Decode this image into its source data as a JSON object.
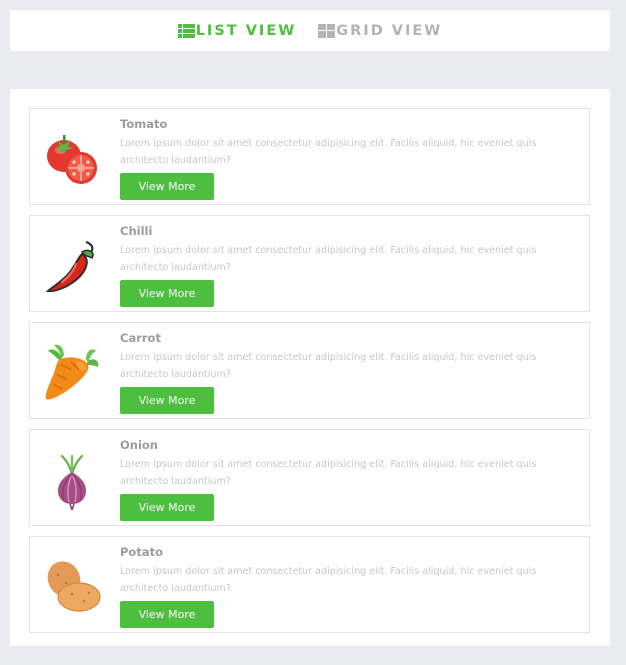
{
  "colors": {
    "accent": "#4cbf3f",
    "inactive": "#b3b3b3",
    "background": "#e9ebf0"
  },
  "toolbar": {
    "list_view_label": "LIST VIEW",
    "list_view_icon": "list-icon",
    "grid_view_label": "GRID VIEW",
    "grid_view_icon": "grid-icon",
    "active_view": "list"
  },
  "items": [
    {
      "name": "Tomato",
      "icon": "tomato-icon",
      "description": "Lorem ipsum dolor sit amet consectetur adipisicing elit. Facilis aliquid, hic eveniet quis architecto laudantium?",
      "button_label": "View More"
    },
    {
      "name": "Chilli",
      "icon": "chilli-icon",
      "description": "Lorem ipsum dolor sit amet consectetur adipisicing elit. Facilis aliquid, hic eveniet quis architecto laudantium?",
      "button_label": "View More"
    },
    {
      "name": "Carrot",
      "icon": "carrot-icon",
      "description": "Lorem ipsum dolor sit amet consectetur adipisicing elit. Facilis aliquid, hic eveniet quis architecto laudantium?",
      "button_label": "View More"
    },
    {
      "name": "Onion",
      "icon": "onion-icon",
      "description": "Lorem ipsum dolor sit amet consectetur adipisicing elit. Facilis aliquid, hic eveniet quis architecto laudantium?",
      "button_label": "View More"
    },
    {
      "name": "Potato",
      "icon": "potato-icon",
      "description": "Lorem ipsum dolor sit amet consectetur adipisicing elit. Facilis aliquid, hic eveniet quis architecto laudantium?",
      "button_label": "View More"
    }
  ]
}
